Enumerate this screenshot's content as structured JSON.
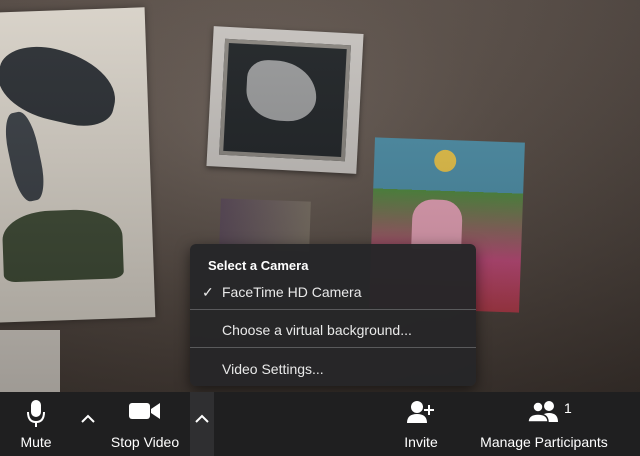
{
  "camera_menu": {
    "header": "Select a Camera",
    "items": [
      {
        "label": "FaceTime HD Camera",
        "checked": true
      },
      {
        "label": "Choose a virtual background...",
        "checked": false
      },
      {
        "label": "Video Settings...",
        "checked": false
      }
    ]
  },
  "toolbar": {
    "mute_label": "Mute",
    "stop_video_label": "Stop Video",
    "invite_label": "Invite",
    "manage_participants_label": "Manage Participants",
    "participant_count": "1",
    "icons": {
      "mute": "microphone-icon",
      "video": "video-camera-icon",
      "invite": "add-person-icon",
      "participants": "people-icon",
      "caret": "chevron-up-icon"
    }
  },
  "colors": {
    "toolbar_bg": "#1f1f20",
    "menu_bg": "#262628",
    "text": "#ffffff"
  }
}
